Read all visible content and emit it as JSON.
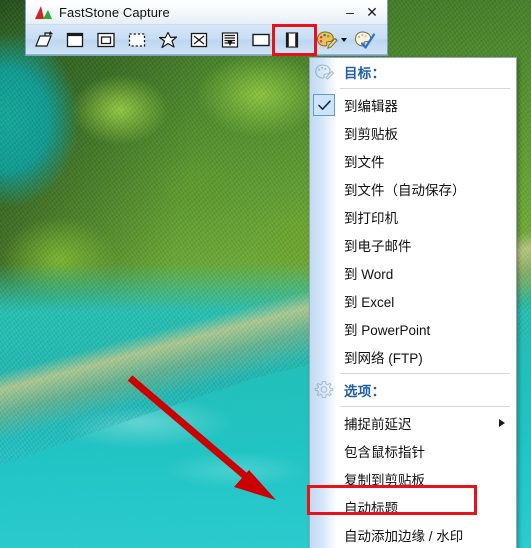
{
  "window": {
    "title": "FastStone Capture",
    "logo_icon": "faststone-logo-icon",
    "minimize_label": "–",
    "close_label": "✕"
  },
  "toolbar": {
    "items": [
      {
        "name": "capture-active-window-icon",
        "label": "Capture Active Window"
      },
      {
        "name": "capture-window-object-icon",
        "label": "Capture Window / Object"
      },
      {
        "name": "capture-rectangular-region-icon",
        "label": "Capture Rectangular Region"
      },
      {
        "name": "capture-freehand-region-icon",
        "label": "Capture Freehand Region"
      },
      {
        "name": "capture-fullscreen-icon",
        "label": "Capture Full Screen"
      },
      {
        "name": "capture-scrolling-window-icon",
        "label": "Capture Scrolling Window"
      },
      {
        "name": "capture-fixed-region-icon",
        "label": "Capture Fixed Region"
      },
      {
        "name": "screen-recorder-icon",
        "label": "Screen Recorder"
      }
    ],
    "dropdown": {
      "name": "output-destination-dropdown",
      "icon": "palette-pencil-icon",
      "caret": "chevron-down-icon"
    },
    "settings": {
      "name": "settings-icon",
      "icon": "palette-check-icon"
    }
  },
  "menu": {
    "destination_header": "目标：",
    "options_header": "选项：",
    "gutter_icons": {
      "destination": "palette-pencil-icon",
      "options": "gear-icon"
    },
    "destinations": [
      {
        "label": "到编辑器",
        "checked": true
      },
      {
        "label": "到剪贴板",
        "checked": false
      },
      {
        "label": "到文件",
        "checked": false
      },
      {
        "label": "到文件（自动保存）",
        "checked": false
      },
      {
        "label": "到打印机",
        "checked": false
      },
      {
        "label": "到电子邮件",
        "checked": false
      },
      {
        "label": "到 Word",
        "checked": false
      },
      {
        "label": "到 Excel",
        "checked": false
      },
      {
        "label": "到 PowerPoint",
        "checked": false
      },
      {
        "label": "到网络 (FTP)",
        "checked": false
      }
    ],
    "options": [
      {
        "label": "捕捉前延迟",
        "submenu": true,
        "highlighted": false
      },
      {
        "label": "包含鼠标指针",
        "submenu": false,
        "highlighted": false
      },
      {
        "label": "复制到剪贴板",
        "submenu": false,
        "highlighted": false
      },
      {
        "label": "自动标题",
        "submenu": false,
        "highlighted": true
      },
      {
        "label": "自动添加边缘 / 水印",
        "submenu": false,
        "highlighted": false
      }
    ]
  },
  "annotations": {
    "arrow": {
      "name": "red-pointer-arrow",
      "color": "#cc0000"
    },
    "palette_box": {
      "name": "palette-button-highlight-box",
      "color": "#e8121b"
    },
    "auto_title_box": {
      "name": "auto-title-highlight-box",
      "color": "#e8121b"
    }
  },
  "colors": {
    "accent_blue": "#1f5fa8",
    "highlight_red": "#e8121b",
    "titlebar_bg": "#f3f7fb",
    "toolbar_bg": "#c6ddf3",
    "menu_bg": "#ffffff",
    "menu_gutter": "#c2d9f2"
  }
}
